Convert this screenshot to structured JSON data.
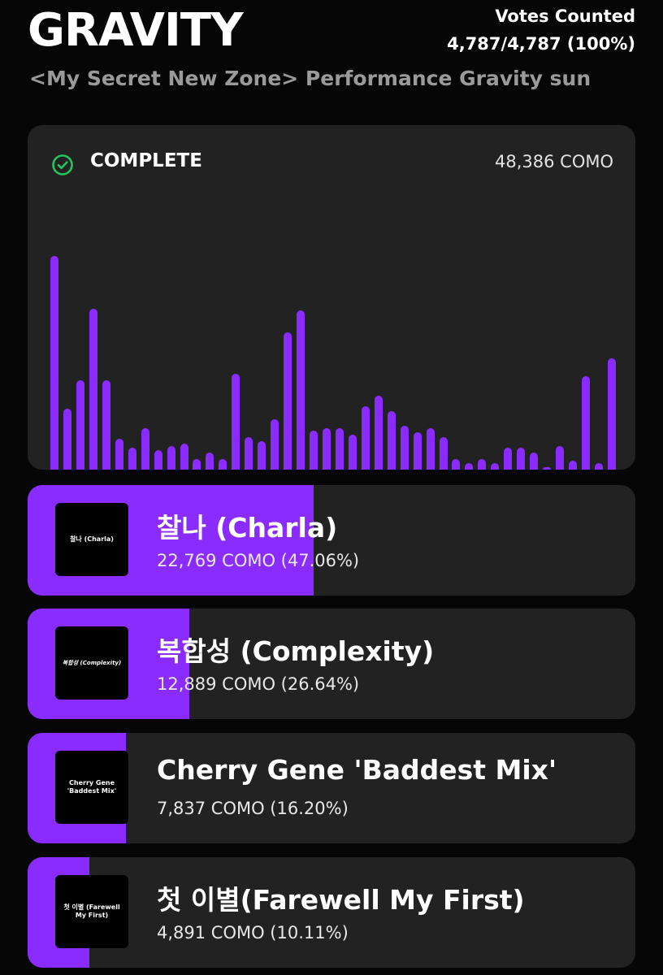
{
  "header": {
    "title": "GRAVITY",
    "votes_label": "Votes Counted",
    "votes_value": "4,787/4,787 (100%)",
    "subtitle": "<My Secret New Zone> Performance Gravity sun"
  },
  "chart_card": {
    "status": "COMPLETE",
    "status_icon": "check-circle-icon",
    "total": "48,386 COMO",
    "accent_color": "#8a2cff",
    "status_color": "#22c55e"
  },
  "chart_data": {
    "type": "bar",
    "title": "",
    "xlabel": "",
    "ylabel": "",
    "values": [
      0.98,
      0.28,
      0.41,
      0.74,
      0.41,
      0.14,
      0.1,
      0.19,
      0.09,
      0.11,
      0.12,
      0.05,
      0.08,
      0.05,
      0.44,
      0.15,
      0.13,
      0.23,
      0.63,
      0.73,
      0.18,
      0.19,
      0.19,
      0.16,
      0.29,
      0.34,
      0.27,
      0.2,
      0.17,
      0.19,
      0.15,
      0.05,
      0.03,
      0.05,
      0.03,
      0.1,
      0.1,
      0.08,
      0.01,
      0.11,
      0.04,
      0.43,
      0.03,
      0.51
    ]
  },
  "options": [
    {
      "name": "찰나 (Charla)",
      "thumb_text": "찰나 (Charla)",
      "stat": "22,769 COMO (47.06%)",
      "share": 47.06
    },
    {
      "name": "복합성 (Complexity)",
      "thumb_text": "복합성 (Complexity)",
      "stat": "12,889 COMO (26.64%)",
      "share": 26.64
    },
    {
      "name": "Cherry Gene 'Baddest Mix'",
      "thumb_text": "Cherry Gene 'Baddest Mix'",
      "stat": "7,837 COMO (16.20%)",
      "share": 16.2
    },
    {
      "name": "첫 이별(Farewell My First)",
      "thumb_text": "첫 이별 (Farewell My First)",
      "stat": "4,891 COMO (10.11%)",
      "share": 10.11
    }
  ]
}
